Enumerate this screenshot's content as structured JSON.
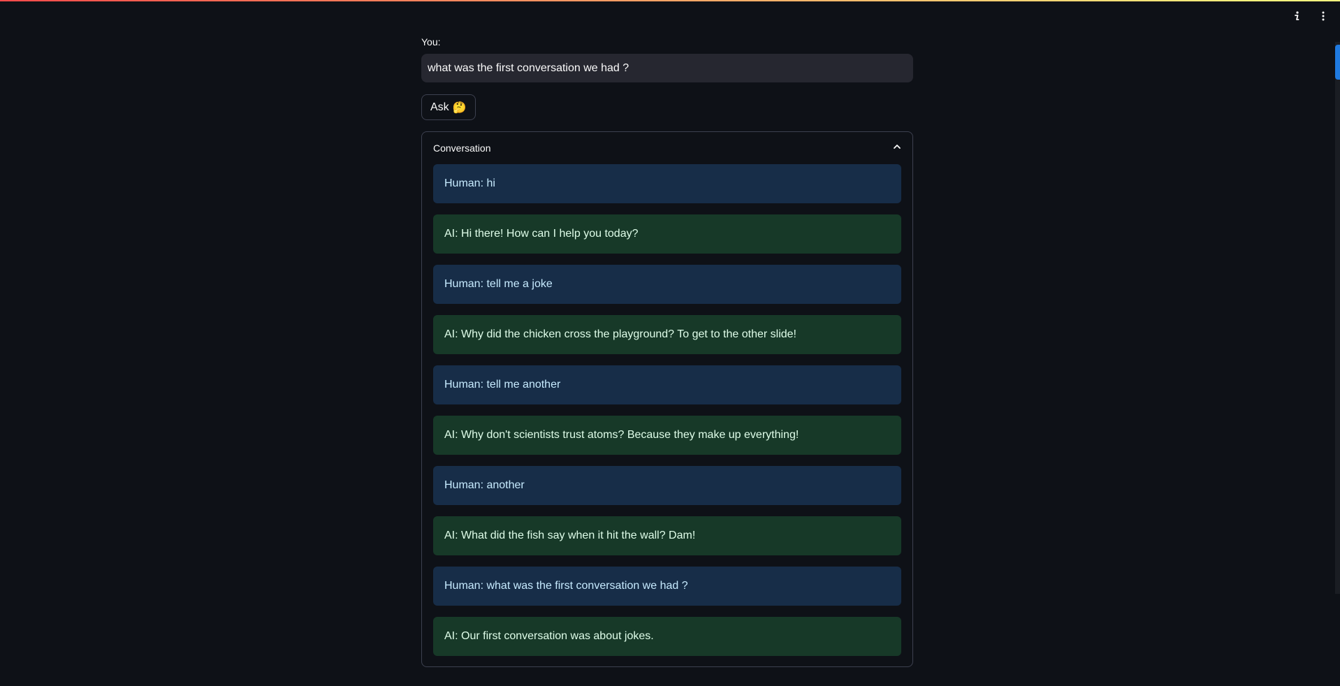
{
  "input": {
    "label": "You:",
    "value": "what was the first conversation we had ?"
  },
  "ask_button": {
    "label": "Ask",
    "emoji": "🤔"
  },
  "conversation": {
    "title": "Conversation",
    "collapse_icon": "chevron-up-icon",
    "messages": [
      {
        "role": "human",
        "text": "Human: hi"
      },
      {
        "role": "ai",
        "text": "AI: Hi there! How can I help you today?"
      },
      {
        "role": "human",
        "text": "Human: tell me a joke"
      },
      {
        "role": "ai",
        "text": "AI: Why did the chicken cross the playground? To get to the other slide!"
      },
      {
        "role": "human",
        "text": "Human: tell me another"
      },
      {
        "role": "ai",
        "text": "AI: Why don't scientists trust atoms? Because they make up everything!"
      },
      {
        "role": "human",
        "text": "Human: another"
      },
      {
        "role": "ai",
        "text": "AI: What did the fish say when it hit the wall? Dam!"
      },
      {
        "role": "human",
        "text": "Human: what was the first conversation we had ?"
      },
      {
        "role": "ai",
        "text": "AI: Our first conversation was about jokes."
      }
    ]
  },
  "toolbar": {
    "icons": [
      "info-icon",
      "more-vertical-icon"
    ]
  },
  "colors": {
    "background": "#0e1117",
    "input_bg": "#262730",
    "human_bg": "#172d48",
    "human_text": "#c7ebff",
    "ai_bg": "#173928",
    "ai_text": "#dffde9",
    "border": "#3d4150",
    "scroll_accent": "#1f7ae0"
  }
}
